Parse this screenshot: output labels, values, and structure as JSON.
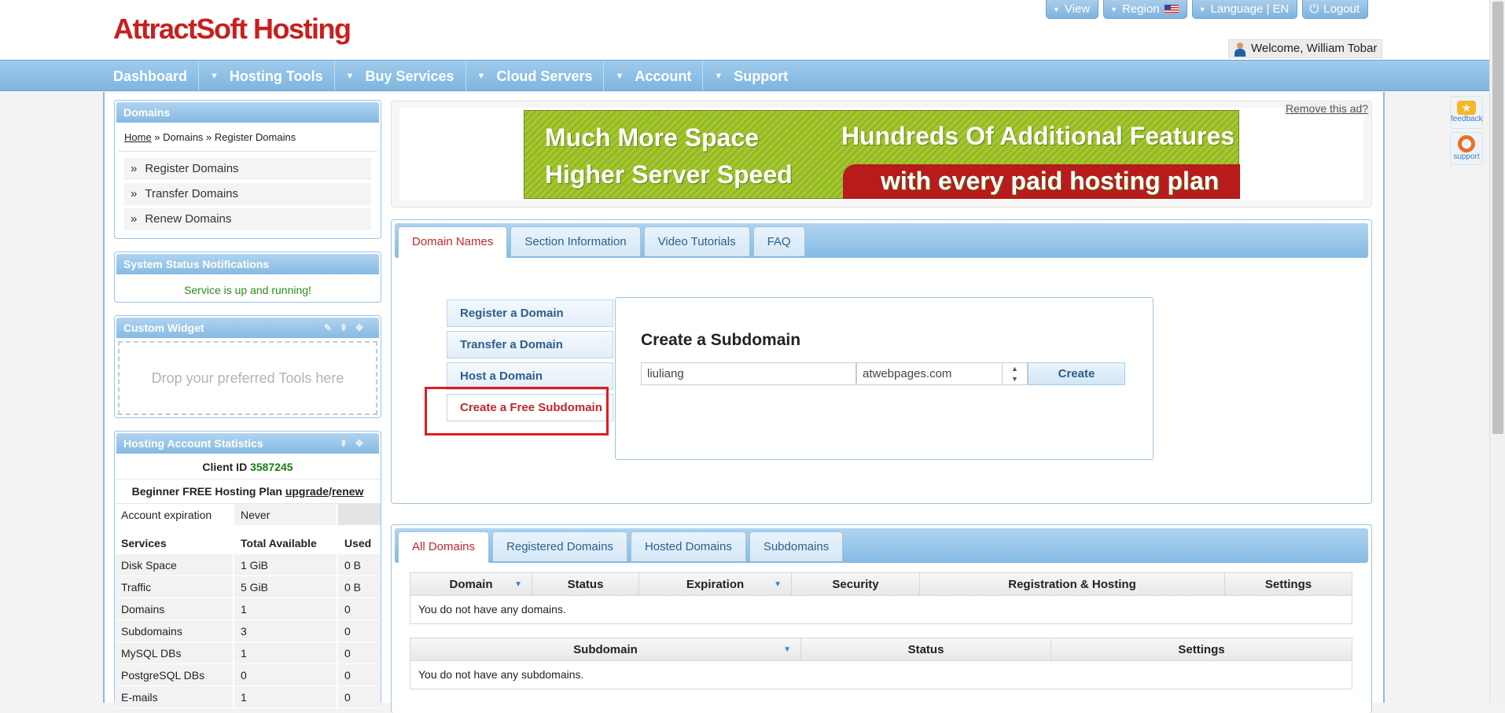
{
  "brand": {
    "name": "AttractSoft Hosting"
  },
  "top_links": [
    {
      "label": "View"
    },
    {
      "label": "Region"
    },
    {
      "label": "Language | EN"
    },
    {
      "label": "Logout"
    }
  ],
  "welcome": "Welcome, William Tobar",
  "nav": [
    "Dashboard",
    "Hosting Tools",
    "Buy Services",
    "Cloud Servers",
    "Account",
    "Support"
  ],
  "sidebar": {
    "domains": {
      "title": "Domains",
      "crumb_home": "Home",
      "crumb_rest": " » Domains » Register Domains",
      "links": [
        "Register Domains",
        "Transfer Domains",
        "Renew Domains"
      ],
      "bullet": "»"
    },
    "status": {
      "title": "System Status Notifications",
      "message": "Service is up and running!"
    },
    "widget": {
      "title": "Custom Widget",
      "drop_text": "Drop your preferred Tools here"
    },
    "stats": {
      "title": "Hosting Account Statistics",
      "client_label": "Client ID ",
      "client_id": "3587245",
      "plan": "Beginner FREE Hosting Plan ",
      "upgrade": "upgrade",
      "slash": "/",
      "renew": "renew",
      "expiration_label": "Account expiration",
      "expiration_value": "Never",
      "headers": [
        "Services",
        "Total Available",
        "Used"
      ],
      "rows": [
        [
          "Disk Space",
          "1 GiB",
          "0 B"
        ],
        [
          "Traffic",
          "5 GiB",
          "0 B"
        ],
        [
          "Domains",
          "1",
          "0"
        ],
        [
          "Subdomains",
          "3",
          "0"
        ],
        [
          "MySQL DBs",
          "1",
          "0"
        ],
        [
          "PostgreSQL DBs",
          "0",
          "0"
        ],
        [
          "E-mails",
          "1",
          "0"
        ]
      ]
    }
  },
  "ad": {
    "remove": "Remove this ad?",
    "line1": "Much More Space",
    "line2": "Higher Server Speed",
    "line3": "Hundreds Of Additional Features",
    "line4": "with every paid hosting plan"
  },
  "domain_panel": {
    "tabs": [
      "Domain Names",
      "Section Information",
      "Video Tutorials",
      "FAQ"
    ],
    "menu": [
      "Register a Domain",
      "Transfer a Domain",
      "Host a Domain",
      "Create a Free Subdomain"
    ],
    "title": "Create a Subdomain",
    "subdomain_value": "liuliang",
    "domain_value": "atwebpages.com",
    "create_label": "Create"
  },
  "list_panel": {
    "tabs": [
      "All Domains",
      "Registered Domains",
      "Hosted Domains",
      "Subdomains"
    ],
    "domains_headers": [
      "Domain",
      "Status",
      "Expiration",
      "Security",
      "Registration & Hosting",
      "Settings"
    ],
    "domains_empty": "You do not have any domains.",
    "sub_headers": [
      "Subdomain",
      "Status",
      "Settings"
    ],
    "sub_empty": "You do not have any subdomains."
  },
  "floating": {
    "feedback": "feedback",
    "support": "support"
  },
  "colors": {
    "brand_red": "#c91e1e",
    "nav_blue": "#8fc0e6",
    "active_tab": "#c0282c",
    "ok_green": "#2a8a1e"
  }
}
